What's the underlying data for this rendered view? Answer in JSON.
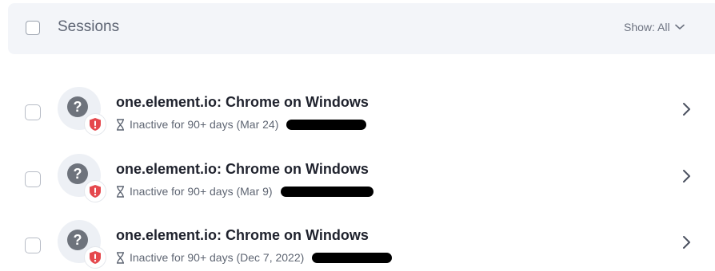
{
  "header": {
    "title": "Sessions",
    "show_filter_label": "Show: All"
  },
  "sessions": [
    {
      "title": "one.element.io: Chrome on Windows",
      "status": "Inactive for 90+ days (Mar 24)"
    },
    {
      "title": "one.element.io: Chrome on Windows",
      "status": "Inactive for 90+ days (Mar 9)"
    },
    {
      "title": "one.element.io: Chrome on Windows",
      "status": "Inactive for 90+ days (Dec 7, 2022)"
    }
  ],
  "icons": {
    "device": "question-mark-icon",
    "badge": "shield-warning-icon",
    "inactive": "hourglass-icon",
    "row_action": "chevron-right-icon",
    "filter_dropdown": "chevron-down-icon"
  },
  "colors": {
    "header_bg": "#f3f5f9",
    "warning_red": "#e5484d",
    "avatar_gray": "#6e737c"
  }
}
